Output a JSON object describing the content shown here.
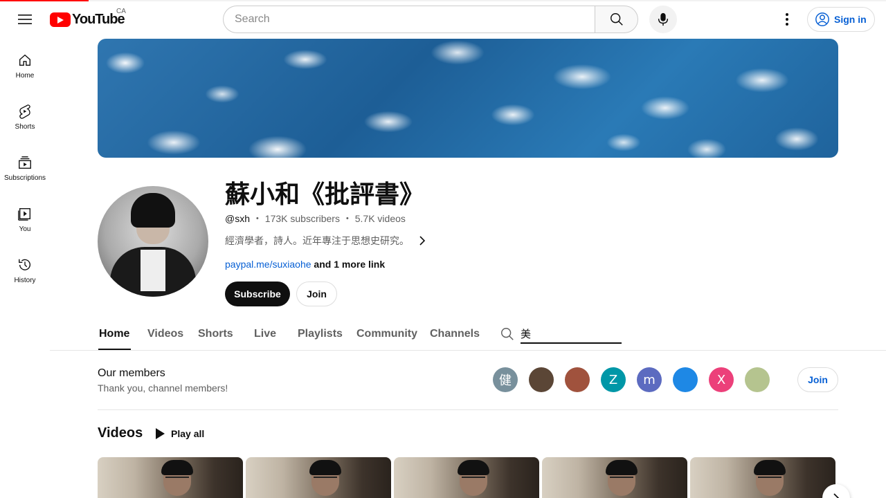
{
  "progress": {
    "percent": 10
  },
  "header": {
    "logo_text": "YouTube",
    "country_code": "CA",
    "search_placeholder": "Search",
    "signin_label": "Sign in"
  },
  "sidebar": {
    "items": [
      {
        "label": "Home",
        "icon": "home-icon"
      },
      {
        "label": "Shorts",
        "icon": "shorts-icon"
      },
      {
        "label": "Subscriptions",
        "icon": "subscriptions-icon"
      },
      {
        "label": "You",
        "icon": "you-icon"
      },
      {
        "label": "History",
        "icon": "history-icon"
      }
    ]
  },
  "channel": {
    "title": "蘇小和《批評書》",
    "handle": "@sxh",
    "subscribers": "173K subscribers",
    "videos_count": "5.7K videos",
    "separator": "・",
    "description": "經濟學者，詩人。近年專注于思想史研究。",
    "link": "paypal.me/suxiaohe",
    "more_links": " and 1 more link",
    "subscribe_label": "Subscribe",
    "join_label": "Join"
  },
  "tabs": {
    "items": [
      "Home",
      "Videos",
      "Shorts",
      "Live",
      "Playlists",
      "Community",
      "Channels"
    ],
    "active": "Home",
    "search_value": "美"
  },
  "members": {
    "title": "Our members",
    "subtitle": "Thank you, channel members!",
    "join_label": "Join",
    "avatars": [
      {
        "letter": "健",
        "color": "#78909c"
      },
      {
        "letter": "",
        "color": "#5b4636"
      },
      {
        "letter": "",
        "color": "#a0523d"
      },
      {
        "letter": "Z",
        "color": "#0097a7"
      },
      {
        "letter": "m",
        "color": "#5c6bc0"
      },
      {
        "letter": "",
        "color": "#1e88e5"
      },
      {
        "letter": "X",
        "color": "#ec407a"
      },
      {
        "letter": "",
        "color": "#b5c48f"
      }
    ]
  },
  "videos": {
    "title": "Videos",
    "play_all_label": "Play all",
    "thumb_count": 5
  }
}
